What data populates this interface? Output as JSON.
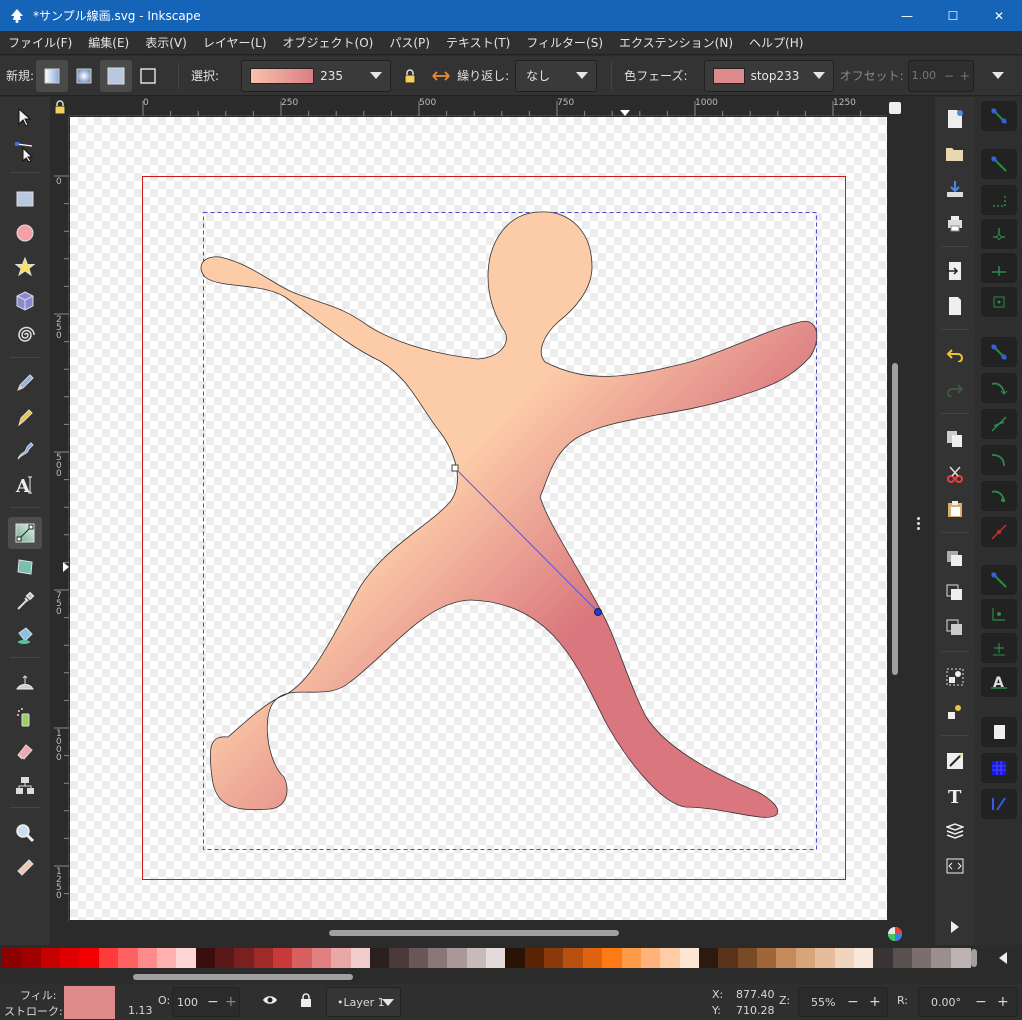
{
  "window": {
    "title": "*サンプル線画.svg - Inkscape",
    "minimize": "—",
    "maximize": "☐",
    "close": "✕"
  },
  "menu": [
    "ファイル(F)",
    "編集(E)",
    "表示(V)",
    "レイヤー(L)",
    "オブジェクト(O)",
    "パス(P)",
    "テキスト(T)",
    "フィルター(S)",
    "エクステンション(N)",
    "ヘルプ(H)"
  ],
  "toolcontrols": {
    "new_label": "新規:",
    "select_label": "選択:",
    "gradient_name": "235",
    "repeat_label": "繰り返し:",
    "repeat_value": "なし",
    "stop_label": "色フェーズ:",
    "stop_name": "stop233",
    "offset_label": "オフセット:",
    "offset_value": "1.00",
    "offset_minus": "−",
    "offset_plus": "+"
  },
  "ruler": {
    "h_ticks": [
      "0",
      "250",
      "500",
      "750",
      "1000",
      "1250"
    ],
    "v_ticks": [
      "0",
      "2\n5\n0",
      "5\n0\n0",
      "7\n5\n0",
      "1\n0\n0\n0",
      "1\n2\n5\n0"
    ]
  },
  "status": {
    "fill_label": "フィル:",
    "stroke_label": "ストローク:",
    "stroke_width": "1.13",
    "opacity_label": "O:",
    "opacity_value": "100",
    "opacity_minus": "−",
    "opacity_plus": "+",
    "layer": "•Layer 1",
    "x_label": "X:",
    "x_value": "877.40",
    "y_label": "Y:",
    "y_value": "710.28",
    "zoom_label": "Z:",
    "zoom_value": "55%",
    "zoom_minus": "−",
    "zoom_plus": "+",
    "rotation_label": "R:",
    "rotation_value": "0.00°",
    "rotation_minus": "−",
    "rotation_plus": "+"
  },
  "colors": {
    "fill": "#df8a8a",
    "gradient_start": "#fccba8",
    "gradient_end": "#d9767e",
    "accent": "#1664b8"
  },
  "palette": [
    "#8c0000",
    "#a00000",
    "#c40000",
    "#e00000",
    "#f00000",
    "#ff3a3a",
    "#ff6262",
    "#ff8a8a",
    "#ffb0b0",
    "#ffd6d6",
    "#3a0e0e",
    "#5a1818",
    "#7a2020",
    "#a02a2a",
    "#c83a3a",
    "#d96060",
    "#e08080",
    "#e8a8a8",
    "#f2cccc",
    "#2a2020",
    "#4a3a3a",
    "#6a5656",
    "#8a7676",
    "#aa9898",
    "#c8baba",
    "#e4dada",
    "#2a1204",
    "#5a2404",
    "#8a3a08",
    "#b85010",
    "#e06410",
    "#ff7a14",
    "#ff9a48",
    "#ffb27a",
    "#ffcca6",
    "#ffe6d2",
    "#2a1a10",
    "#5a341a",
    "#7a4a24",
    "#a0663a",
    "#c48a5a",
    "#d8a47a",
    "#e6bc9c",
    "#f0d4bc",
    "#f8e8dc",
    "#3a3434",
    "#5a5050",
    "#7a6e6e",
    "#9a8e8e",
    "#bcb2b2"
  ]
}
